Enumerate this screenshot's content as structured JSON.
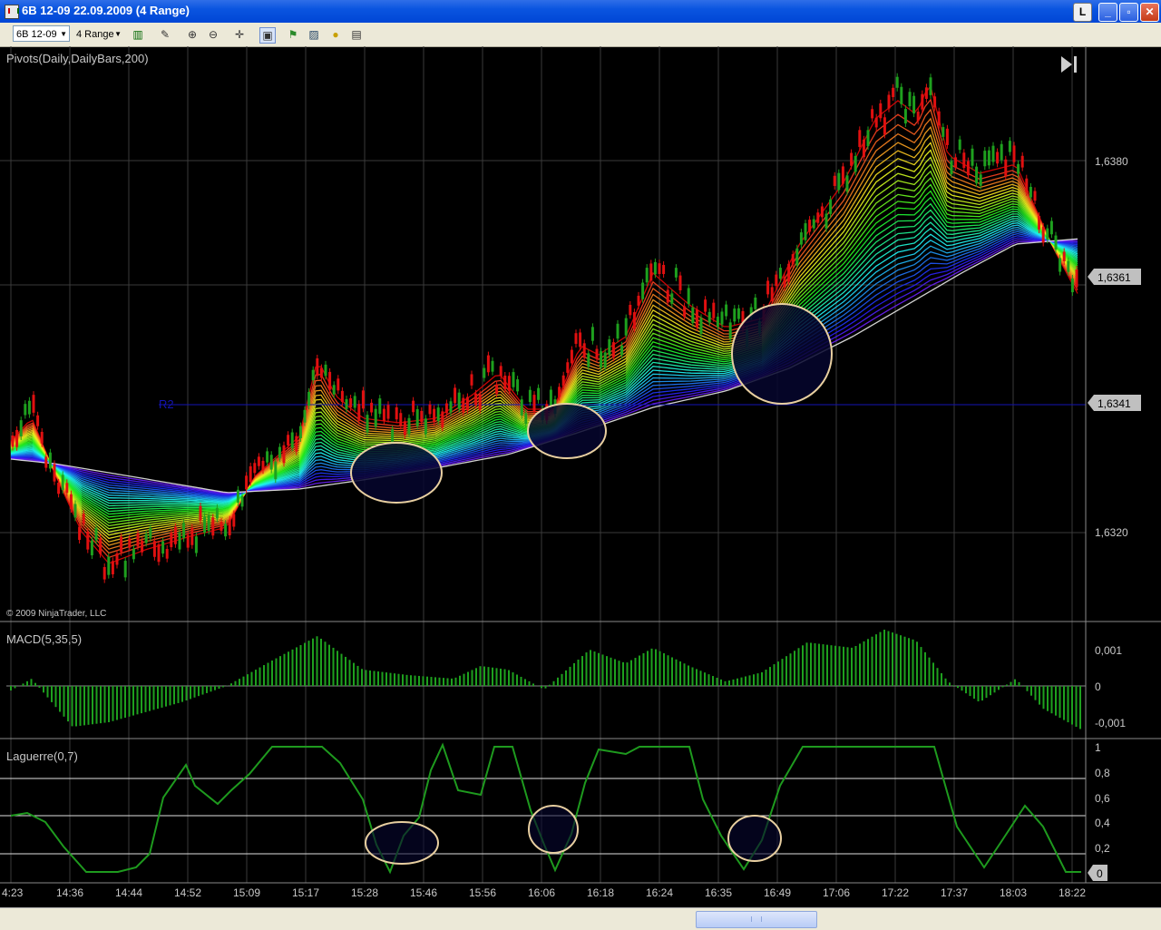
{
  "window": {
    "title": "6B 12-09   22.09.2009 (4 Range)",
    "btn_l": "L"
  },
  "toolbar": {
    "instrument": "6B 12-09",
    "interval": "4 Range"
  },
  "panels": {
    "price": {
      "label": "Pivots(Daily,DailyBars,200)",
      "pivot_label": "R2",
      "copyright": "© 2009 NinjaTrader, LLC",
      "tick_labels": [
        "1,6380",
        "1,6320"
      ],
      "price_tag": "1,6361",
      "pivot_tag": "1,6341"
    },
    "macd": {
      "label": "MACD(5,35,5)",
      "tick_labels": [
        "0,001",
        "0",
        "-0,001"
      ]
    },
    "laguerre": {
      "label": "Laguerre(0,7)",
      "tick_labels": [
        "1",
        "0,8",
        "0,6",
        "0,4",
        "0,2"
      ],
      "value_tag": "0"
    }
  },
  "x_axis": {
    "labels": [
      "4:23",
      "14:36",
      "14:44",
      "14:52",
      "15:09",
      "15:17",
      "15:28",
      "15:46",
      "15:56",
      "16:06",
      "16:18",
      "16:24",
      "16:35",
      "16:49",
      "17:06",
      "17:22",
      "17:37",
      "18:03",
      "18:22"
    ]
  },
  "colors": {
    "up": "#1ea01e",
    "down": "#e01010",
    "pivot": "#1414b4",
    "grid": "#3a3a3a",
    "laguerre": "#1e9a1e",
    "circle": "#e8cfa0"
  },
  "chart_data": {
    "type": "candlestick",
    "price_ticks": [
      1.632,
      1.638
    ],
    "current_price": 1.6361,
    "pivot_R2": 1.6341,
    "macd_ticks": [
      0.001,
      0,
      -0.001
    ],
    "laguerre_levels": [
      0.2,
      0.4,
      0.6,
      0.8,
      1
    ]
  }
}
